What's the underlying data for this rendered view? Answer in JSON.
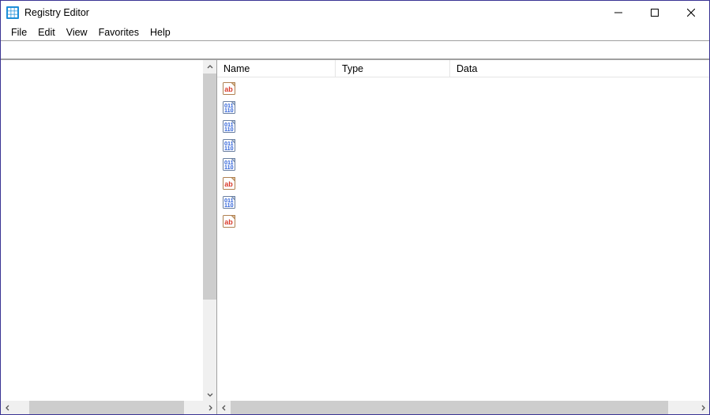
{
  "titlebar": {
    "title": "Registry Editor"
  },
  "menubar": {
    "items": [
      "File",
      "Edit",
      "View",
      "Favorites",
      "Help"
    ]
  },
  "addressbar": {
    "path": ""
  },
  "columns": {
    "name": "Name",
    "type": "Type",
    "data": "Data"
  },
  "values": [
    {
      "icon": "string"
    },
    {
      "icon": "binary"
    },
    {
      "icon": "binary"
    },
    {
      "icon": "binary"
    },
    {
      "icon": "binary"
    },
    {
      "icon": "string"
    },
    {
      "icon": "binary"
    },
    {
      "icon": "string"
    }
  ]
}
